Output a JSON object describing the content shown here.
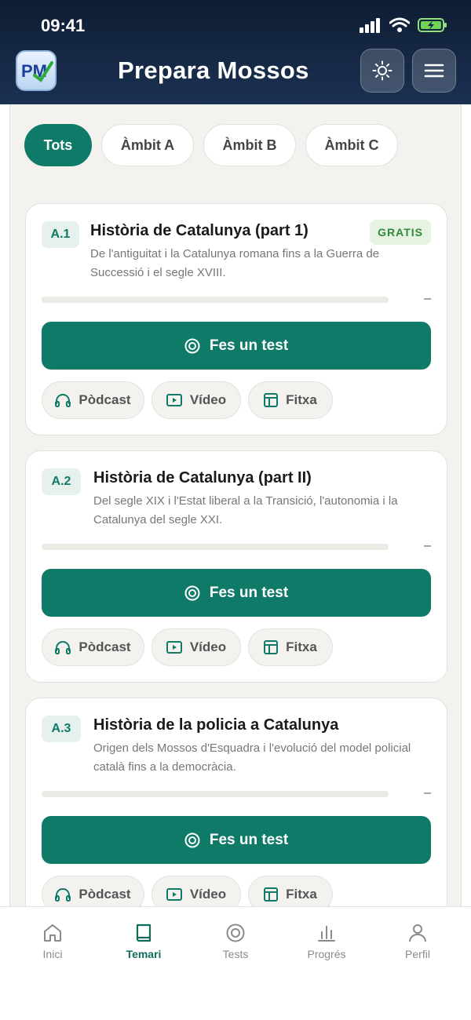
{
  "status": {
    "time": "09:41"
  },
  "app": {
    "title": "Prepara Mossos"
  },
  "filters": [
    {
      "label": "Tots",
      "active": true
    },
    {
      "label": "Àmbit A",
      "active": false
    },
    {
      "label": "Àmbit B",
      "active": false
    },
    {
      "label": "Àmbit C",
      "active": false
    }
  ],
  "cards": [
    {
      "code": "A.1",
      "title": "Història de Catalunya (part 1)",
      "description": "De l'antiguitat i la Catalunya romana fins a la Guerra de Successió i el segle XVIII.",
      "badge": "GRATIS",
      "progress": 0,
      "progress_text": "–",
      "test_label": "Fes un test",
      "resources": [
        "Pòdcast",
        "Vídeo",
        "Fitxa"
      ]
    },
    {
      "code": "A.2",
      "title": "Història de Catalunya (part II)",
      "description": "Del segle XIX i l'Estat liberal a la Transició, l'autonomia i la Catalunya del segle XXI.",
      "progress": 0,
      "progress_text": "–",
      "test_label": "Fes un test",
      "resources": [
        "Pòdcast",
        "Vídeo",
        "Fitxa"
      ]
    },
    {
      "code": "A.3",
      "title": "Història de la policia a Catalunya",
      "description": "Origen dels Mossos d'Esquadra i l'evolució del model policial català fins a la democràcia.",
      "progress": 0,
      "progress_text": "–",
      "test_label": "Fes un test",
      "resources": [
        "Pòdcast",
        "Vídeo",
        "Fitxa"
      ]
    }
  ],
  "nav": [
    {
      "label": "Inici",
      "icon": "home-icon",
      "active": false
    },
    {
      "label": "Temari",
      "icon": "book-icon",
      "active": true
    },
    {
      "label": "Tests",
      "icon": "target-icon",
      "active": false
    },
    {
      "label": "Progrés",
      "icon": "bar-chart-icon",
      "active": false
    },
    {
      "label": "Perfil",
      "icon": "user-icon",
      "active": false
    }
  ],
  "colors": {
    "accent": "#0f7a68",
    "header": "#14243e",
    "background": "#f3f2ef"
  }
}
